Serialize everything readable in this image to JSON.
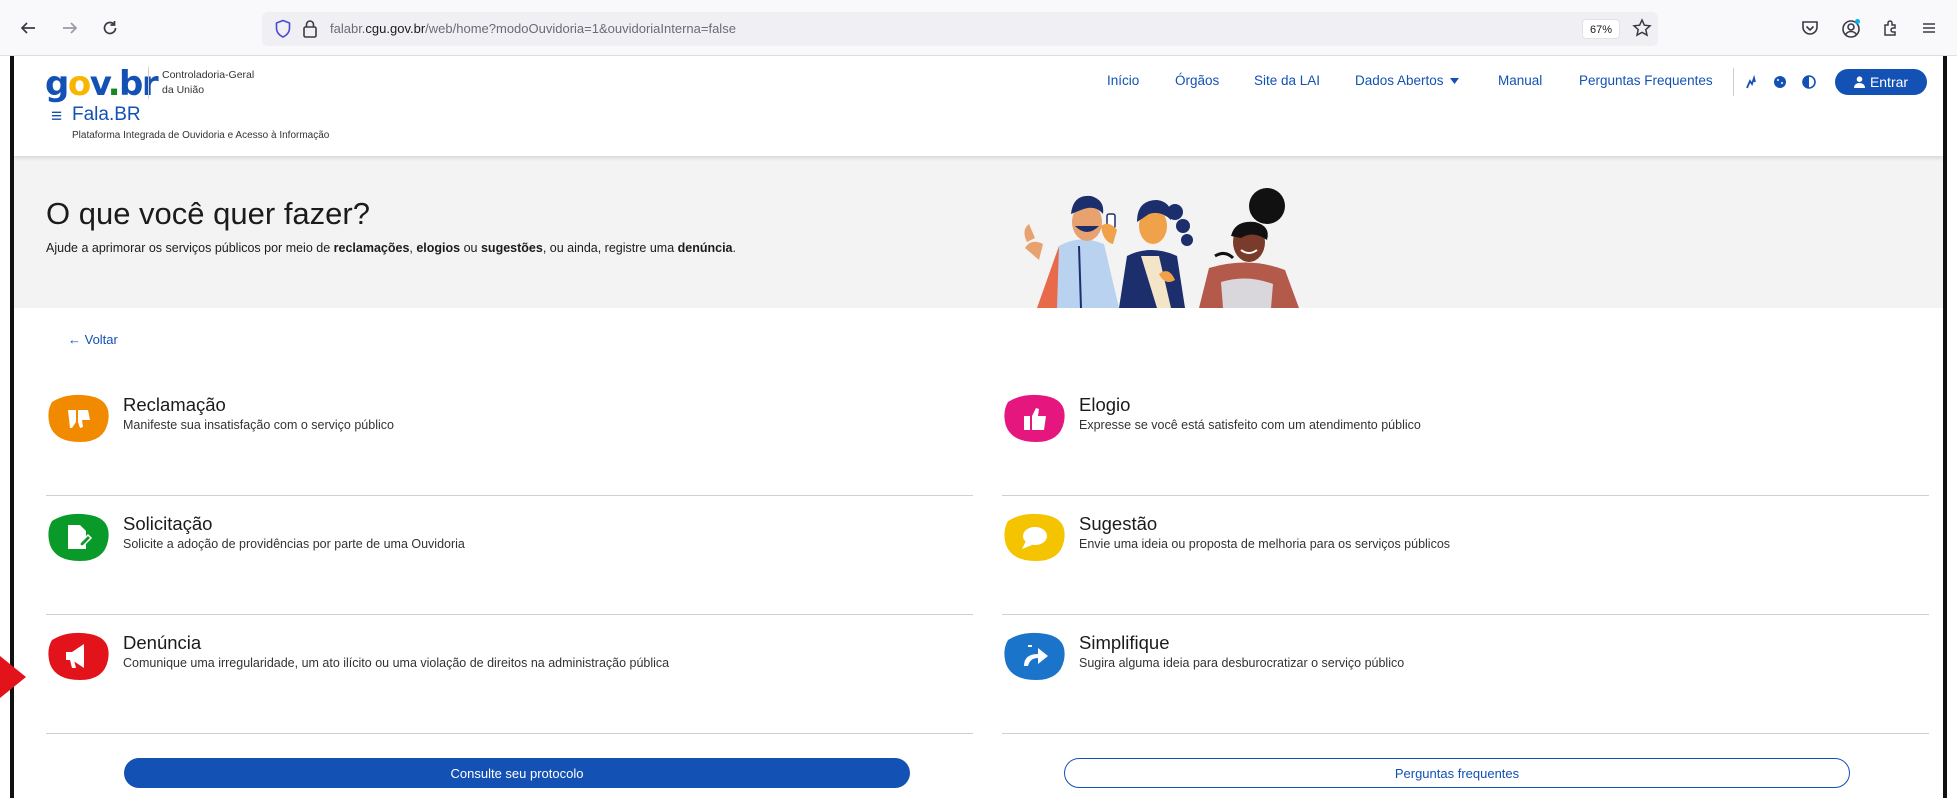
{
  "browser": {
    "url_prefix": "falabr.",
    "url_domain": "cgu.gov.br",
    "url_path": "/web/home?modoOuvidoria=1&ouvidoriaInterna=false",
    "zoom": "67%"
  },
  "header": {
    "logo_g": "g",
    "logo_o": "o",
    "logo_v": "v",
    "logo_dot": ".",
    "logo_br": "br",
    "org_line1": "Controladoria-Geral",
    "org_line2": "da União",
    "menu_glyph": "≡",
    "site_name": "Fala.BR",
    "site_subtitle": "Plataforma Integrada de Ouvidoria e Acesso à Informação",
    "nav": {
      "inicio": "Início",
      "orgaos": "Órgãos",
      "site_lai": "Site da LAI",
      "dados_abertos": "Dados Abertos",
      "manual": "Manual",
      "perguntas": "Perguntas Frequentes"
    },
    "login_label": "Entrar"
  },
  "hero": {
    "title": "O que você quer fazer?",
    "desc_1": "Ajude a aprimorar os serviços públicos por meio de ",
    "desc_b1": "reclamações",
    "desc_2": ", ",
    "desc_b2": "elogios",
    "desc_3": " ou ",
    "desc_b3": "sugestões",
    "desc_4": ", ou ainda, registre uma ",
    "desc_b4": "denúncia",
    "desc_5": "."
  },
  "back_link": "← Voltar",
  "options": {
    "reclamacao": {
      "title": "Reclamação",
      "desc": "Manifeste sua insatisfação com o serviço público",
      "color": "#f28a00",
      "icon": "thumbs-down-icon"
    },
    "elogio": {
      "title": "Elogio",
      "desc": "Expresse se você está satisfeito com um atendimento público",
      "color": "#e5177e",
      "icon": "thumbs-up-icon"
    },
    "solicitacao": {
      "title": "Solicitação",
      "desc": "Solicite a adoção de providências por parte de uma Ouvidoria",
      "color": "#0a9a29",
      "icon": "document-edit-icon"
    },
    "sugestao": {
      "title": "Sugestão",
      "desc": "Envie uma ideia ou proposta de melhoria para os serviços públicos",
      "color": "#f5c400",
      "icon": "speech-bubble-icon"
    },
    "denuncia": {
      "title": "Denúncia",
      "desc": "Comunique uma irregularidade, um ato ilícito ou uma violação de direitos na administração pública",
      "color": "#e3131b",
      "icon": "megaphone-icon"
    },
    "simplifique": {
      "title": "Simplifique",
      "desc": "Sugira alguma ideia para desburocratizar o serviço público",
      "color": "#1a74c9",
      "icon": "share-arrow-icon"
    }
  },
  "buttons": {
    "consulte": "Consulte seu protocolo",
    "perguntas": "Perguntas frequentes"
  },
  "colors": {
    "primary": "#1351b4",
    "hero_bg": "#f3f3f3",
    "annotation_arrow": "#e3131b"
  }
}
